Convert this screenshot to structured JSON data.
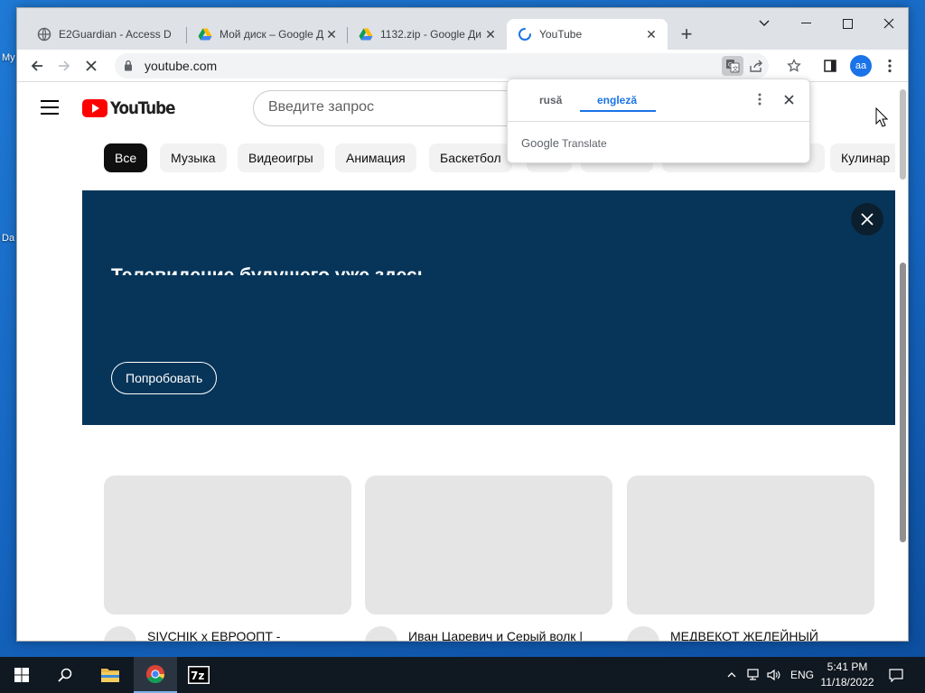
{
  "desktop": {
    "icons": [
      "My",
      "Da"
    ]
  },
  "browser": {
    "tabs": [
      {
        "title": "E2Guardian - Access D",
        "icon": "globe-icon"
      },
      {
        "title": "Мой диск – Google Д",
        "icon": "google-drive-icon"
      },
      {
        "title": "1132.zip - Google Ди",
        "icon": "google-drive-icon"
      },
      {
        "title": "YouTube",
        "icon": "loading-spinner-icon",
        "active": true
      }
    ],
    "address": "youtube.com",
    "profile_initials": "aa"
  },
  "youtube": {
    "logo_text": "YouTube",
    "search_placeholder": "Введите запрос",
    "chips": [
      "Все",
      "Музыка",
      "Видеоигры",
      "Анимация",
      "Баскетбол",
      "",
      "",
      "",
      "Кулинар"
    ],
    "banner": {
      "headline": "Телевидение будущего уже здесь",
      "button": "Попробовать"
    },
    "videos": [
      {
        "title": "SIVCHIK x ЕВРООПТ -"
      },
      {
        "title": "Иван Царевич и Серый волк |"
      },
      {
        "title": "МЕДВЕКОТ ЖЕЛЕЙНЫЙ"
      }
    ]
  },
  "translate_popup": {
    "source_lang": "rusă",
    "target_lang": "engleză",
    "brand": "Google",
    "product": "Translate"
  },
  "taskbar": {
    "language": "ENG",
    "time": "5:41 PM",
    "date": "11/18/2022"
  },
  "colors": {
    "youtube_red": "#ff0000",
    "banner_bg": "#073559",
    "accent_blue": "#1a73e8"
  }
}
